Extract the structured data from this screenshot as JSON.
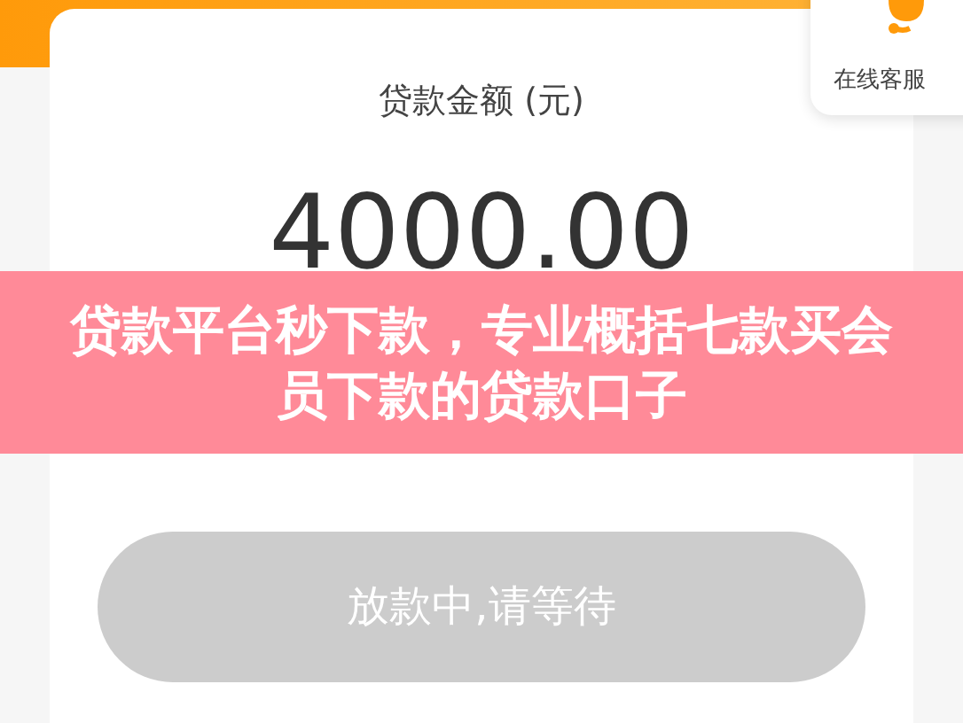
{
  "service": {
    "label": "在线客服"
  },
  "loan": {
    "label": "贷款金额 (元)",
    "amount": "4000.00"
  },
  "action_button": {
    "label": "放款中,请等待",
    "disabled": true
  },
  "banner": {
    "title": "贷款平台秒下款，专业概括七款买会员下款的贷款口子"
  }
}
